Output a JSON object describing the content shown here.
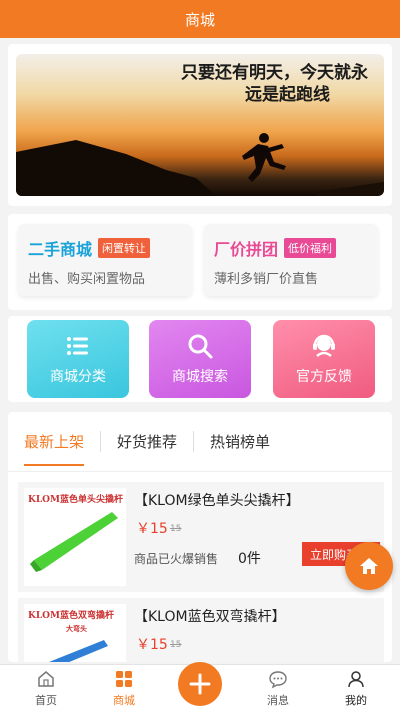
{
  "header": {
    "title": "商城"
  },
  "banner": {
    "line1": "只要还有明天，今天就永",
    "line2": "远是起跑线"
  },
  "promos": [
    {
      "title": "二手商城",
      "badge": "闲置转让",
      "subtitle": "出售、购买闲置物品"
    },
    {
      "title": "厂价拼团",
      "badge": "低价福利",
      "subtitle": "薄利多销厂价直售"
    }
  ],
  "categories": [
    {
      "label": "商城分类",
      "icon": "list-icon"
    },
    {
      "label": "商城搜索",
      "icon": "search-icon"
    },
    {
      "label": "官方反馈",
      "icon": "support-icon"
    }
  ],
  "tabs": [
    "最新上架",
    "好货推荐",
    "热销榜单"
  ],
  "products": [
    {
      "thumb_text": "KLOM蓝色单头尖撬杆",
      "name": "【KLOM绿色单头尖撬杆】",
      "price": "￥15",
      "old_price": "15",
      "sold_label": "商品已火爆销售",
      "sold_value": "0件",
      "buy_label": "立即购买"
    },
    {
      "thumb_text": "KLOM蓝色双弯撬杆",
      "thumb_sub": "大弯头",
      "name": "【KLOM蓝色双弯撬杆】",
      "price": "￥15",
      "old_price": "15"
    }
  ],
  "bottom_nav": [
    {
      "label": "首页",
      "icon": "home-icon"
    },
    {
      "label": "商城",
      "icon": "grid-icon",
      "active": true
    },
    {
      "label": "",
      "icon": "plus-icon"
    },
    {
      "label": "消息",
      "icon": "chat-icon"
    },
    {
      "label": "我的",
      "icon": "user-icon"
    }
  ],
  "colors": {
    "accent": "#f27a22",
    "price": "#e8402c",
    "blue": "#1aa3d9",
    "pink": "#e84a95"
  }
}
